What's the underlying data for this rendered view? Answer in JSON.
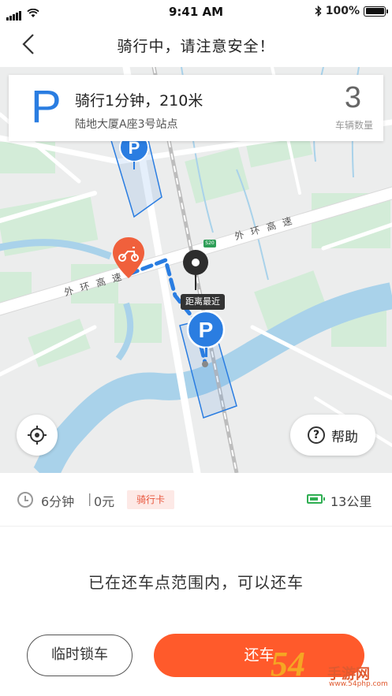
{
  "status_bar": {
    "time": "9:41 AM",
    "battery": "100%"
  },
  "nav": {
    "title": "骑行中，请注意安全！"
  },
  "info_card": {
    "parking_letter": "P",
    "summary": "骑行1分钟，210米",
    "station": "陆地大厦A座3号站点",
    "vehicle_count": "3",
    "vehicle_count_label": "车辆数量"
  },
  "map": {
    "road_name": "外环高速",
    "nearest_tag": "距离最近",
    "road_shield": "S20",
    "marker_letter": "P",
    "help_label": "帮助",
    "help_glyph": "?"
  },
  "trip": {
    "duration": "6分钟",
    "separator": "|",
    "cost": "0元",
    "card_badge": "骑行卡",
    "range": "13公里"
  },
  "return_hint": "已在还车点范围内，可以还车",
  "buttons": {
    "temp_lock": "临时锁车",
    "return": "还车"
  },
  "watermark": {
    "number": "54",
    "text": "手游网",
    "url": "www.54php.com"
  },
  "colors": {
    "accent": "#ff5a2b",
    "parking_blue": "#2a7de1",
    "battery_green": "#2fae52",
    "scooter_orange": "#f0603c"
  },
  "icons": [
    "back-arrow-icon",
    "wifi-icon",
    "bluetooth-icon",
    "clock-icon",
    "battery-icon",
    "locate-icon",
    "help-icon",
    "scooter-icon",
    "pin-icon"
  ]
}
